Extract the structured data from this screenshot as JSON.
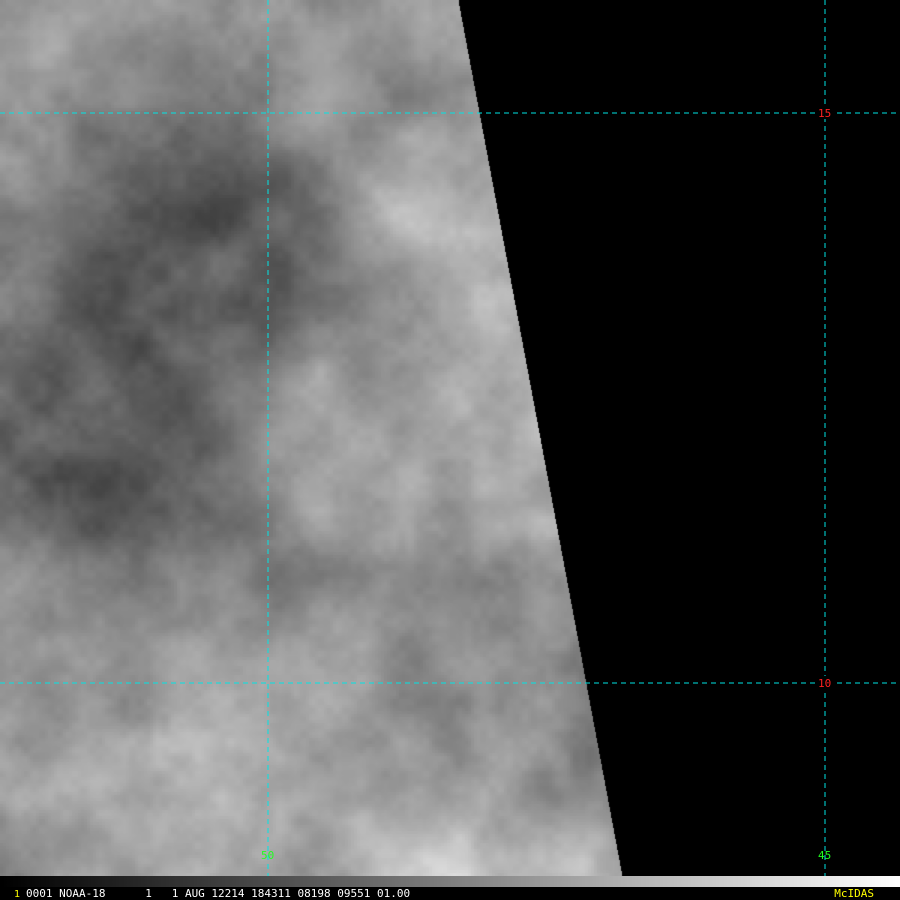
{
  "status_bar": {
    "frame_number": "1",
    "text": "0001 NOAA-18      1   1 AUG 12214 184311 08198 09551 01.00",
    "software": "McIDAS"
  },
  "grid": {
    "latitudes": [
      {
        "label": "15"
      },
      {
        "label": "10"
      }
    ],
    "longitudes": [
      {
        "label": "50"
      },
      {
        "label": "45"
      }
    ]
  },
  "colors": {
    "grid_line": "#00e5e5",
    "latitude_label": "#ff2020",
    "longitude_label": "#20ff20",
    "frame_number": "#ffff00",
    "software_label": "#ffff00",
    "background": "#000000"
  }
}
